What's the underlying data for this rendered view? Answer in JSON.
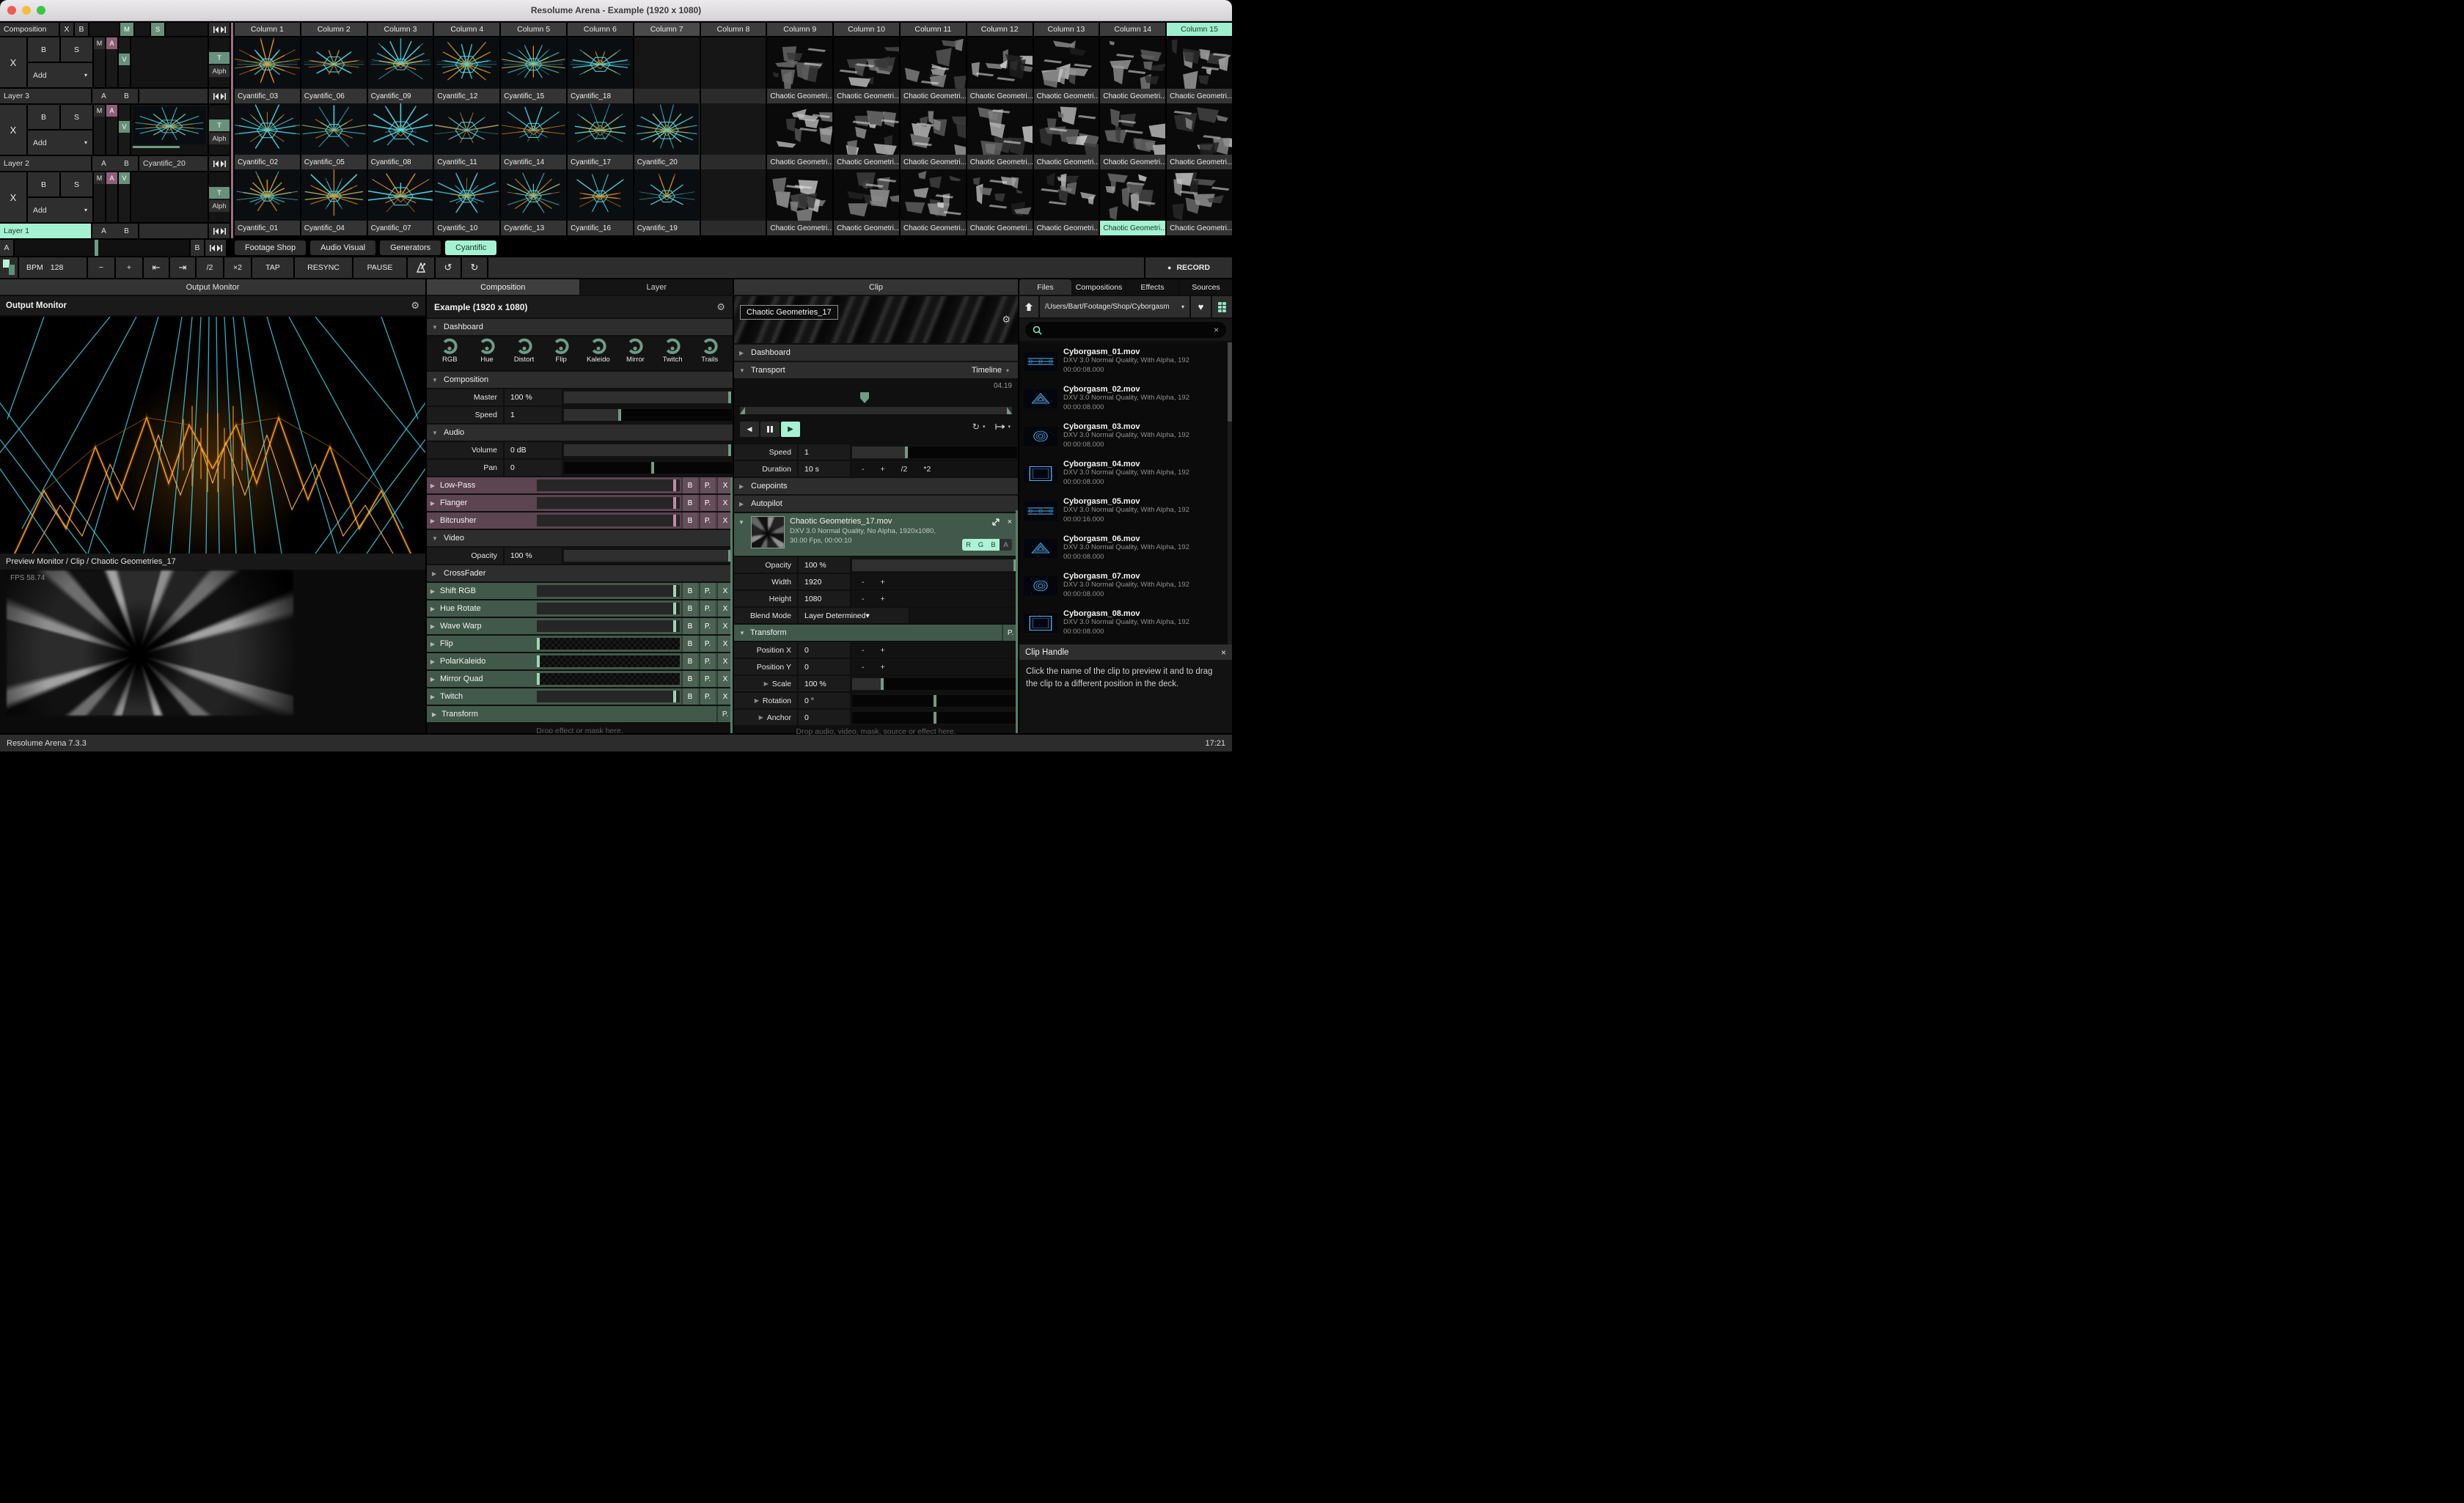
{
  "window": {
    "title": "Resolume Arena - Example (1920 x 1080)"
  },
  "colors": {
    "accent_mint": "#a5f2d3",
    "green_button": "#67917d",
    "purple_button": "#8f5f78",
    "audio_fx_bg": "#5c4450",
    "video_fx_bg": "#41594b",
    "slider_handle": "#6f9c86",
    "audio_fx_handle": "#c08ba4",
    "video_fx_handle": "#9fd4b8",
    "clip_cyan": "#49d8e8",
    "clip_orange": "#e8951c"
  },
  "icons": {
    "gear": "⚙",
    "heart": "♥",
    "chevron_down": "▾",
    "section_open": "▼",
    "section_closed": "▶",
    "close": "×",
    "play": "▶",
    "prev": "◀",
    "record_dot": "●",
    "undo": "↺",
    "redo": "↻",
    "nudge_left": "⇤",
    "nudge_right": "⇥",
    "loop": "↻"
  },
  "deck": {
    "composition": {
      "label": "Composition",
      "clear": "X",
      "bypass": "B",
      "master": "M",
      "solo": "S"
    },
    "layers": [
      {
        "name": "Layer 3",
        "clear": "X",
        "bypass": "B",
        "solo": "S",
        "blend": "Add",
        "m": "M",
        "a": "A",
        "v": "V",
        "t": "T",
        "alpha": "Alph",
        "ab_a": "A",
        "ab_b": "B",
        "clip": "",
        "selected": false,
        "v_top": false
      },
      {
        "name": "Layer 2",
        "clear": "X",
        "bypass": "B",
        "solo": "S",
        "blend": "Add",
        "m": "M",
        "a": "A",
        "v": "V",
        "t": "T",
        "alpha": "Alph",
        "ab_a": "A",
        "ab_b": "B",
        "clip": "Cyantific_20",
        "clip_seed": 20,
        "progress": 0.62,
        "selected": false,
        "v_top": false
      },
      {
        "name": "Layer 1",
        "clear": "X",
        "bypass": "B",
        "solo": "S",
        "blend": "Add",
        "m": "M",
        "a": "A",
        "v": "V",
        "t": "T",
        "alpha": "Alph",
        "ab_a": "A",
        "ab_b": "B",
        "clip": "",
        "selected": true,
        "v_top": true
      }
    ],
    "crossfader": {
      "a": "A",
      "b": "B",
      "position": 0.46
    }
  },
  "grid": {
    "columns": [
      "Column 1",
      "Column 2",
      "Column 3",
      "Column 4",
      "Column 5",
      "Column 6",
      "Column 7",
      "Column 8",
      "Column 9",
      "Column 10",
      "Column 11",
      "Column 12",
      "Column 13",
      "Column 14",
      "Column 15"
    ],
    "hover_col": 6,
    "active_col": 14,
    "rows": [
      [
        "Cyantific_03",
        "Cyantific_06",
        "Cyantific_09",
        "Cyantific_12",
        "Cyantific_15",
        "Cyantific_18",
        "",
        "",
        "Chaotic Geometri...",
        "Chaotic Geometri...",
        "Chaotic Geometri...",
        "Chaotic Geometri...",
        "Chaotic Geometri...",
        "Chaotic Geometri...",
        "Chaotic Geometri..."
      ],
      [
        "Cyantific_02",
        "Cyantific_05",
        "Cyantific_08",
        "Cyantific_11",
        "Cyantific_14",
        "Cyantific_17",
        "Cyantific_20",
        "",
        "Chaotic Geometri...",
        "Chaotic Geometri...",
        "Chaotic Geometri...",
        "Chaotic Geometri...",
        "Chaotic Geometri...",
        "Chaotic Geometri...",
        "Chaotic Geometri..."
      ],
      [
        "Cyantific_01",
        "Cyantific_04",
        "Cyantific_07",
        "Cyantific_10",
        "Cyantific_13",
        "Cyantific_16",
        "Cyantific_19",
        "",
        "Chaotic Geometri...",
        "Chaotic Geometri...",
        "Chaotic Geometri...",
        "Chaotic Geometri...",
        "Chaotic Geometri...",
        "Chaotic Geometri...",
        "Chaotic Geometri..."
      ]
    ],
    "selected": {
      "row": 1,
      "col": 6
    },
    "playing": {
      "row": 2,
      "col": 13
    }
  },
  "deck_tabs": {
    "items": [
      "Footage Shop",
      "Audio Visual",
      "Generators",
      "Cyantific"
    ],
    "active_index": 3
  },
  "bpm": {
    "label": "BPM",
    "value": "128",
    "cells": [
      {
        "label": "−",
        "w": 36,
        "name": "bpm-minus-button"
      },
      {
        "label": "+",
        "w": 36,
        "name": "bpm-plus-button"
      },
      {
        "icon": "nudge_left",
        "w": 34,
        "name": "bpm-nudge-down-button"
      },
      {
        "icon": "nudge_right",
        "w": 34,
        "name": "bpm-nudge-up-button"
      },
      {
        "label": "/2",
        "w": 36,
        "name": "bpm-half-button"
      },
      {
        "label": "×2",
        "w": 36,
        "name": "bpm-double-button"
      },
      {
        "label": "TAP",
        "w": 56,
        "name": "tap-button"
      },
      {
        "label": "RESYNC",
        "w": 78,
        "name": "resync-button"
      },
      {
        "label": "PAUSE",
        "w": 72,
        "name": "pause-button"
      },
      {
        "icon": "metronome",
        "w": 36,
        "name": "metronome-button"
      },
      {
        "icon": "undo",
        "w": 34,
        "name": "undo-button"
      },
      {
        "icon": "redo",
        "w": 34,
        "name": "redo-button"
      }
    ],
    "record": "RECORD"
  },
  "output_monitor": {
    "tab": "Output Monitor",
    "header": "Output Monitor",
    "preview_header": "Preview Monitor / Clip / Chaotic Geometries_17",
    "fps": "FPS 58.74"
  },
  "composition_panel": {
    "tabs": [
      {
        "label": "Composition"
      },
      {
        "label": "Layer"
      }
    ],
    "active_tab": 0,
    "title": "Example (1920 x 1080)",
    "dashboard_label": "Dashboard",
    "knobs": [
      "RGB",
      "Hue",
      "Distort",
      "Flip",
      "Kaleido",
      "Mirror",
      "Twitch",
      "Trails"
    ],
    "rows": [
      {
        "kind": "header",
        "label": "Composition",
        "open": true
      },
      {
        "kind": "param",
        "label": "Master",
        "value": "100 %",
        "slider": {
          "fill": 0.985,
          "handle": 0.985
        }
      },
      {
        "kind": "param",
        "label": "Speed",
        "value": "1",
        "slider": {
          "fill": 0.33,
          "handle": 0.33
        }
      },
      {
        "kind": "header",
        "label": "Audio",
        "open": true
      },
      {
        "kind": "param",
        "label": "Volume",
        "value": "0 dB",
        "slider": {
          "fill": 0.985,
          "handle": 0.985
        }
      },
      {
        "kind": "param",
        "label": "Pan",
        "value": "0",
        "slider": {
          "fill": 0,
          "handle": 0.53
        }
      },
      {
        "kind": "fx",
        "theme": "audio",
        "label": "Low-Pass",
        "buttons": [
          "B",
          "P.",
          "X"
        ],
        "handle": 0.965
      },
      {
        "kind": "fx",
        "theme": "audio",
        "label": "Flanger",
        "buttons": [
          "B",
          "P.",
          "X"
        ],
        "handle": 0.965
      },
      {
        "kind": "fx",
        "theme": "audio",
        "label": "Bitcrusher",
        "buttons": [
          "B",
          "P.",
          "X"
        ],
        "handle": 0.965
      },
      {
        "kind": "header",
        "label": "Video",
        "open": true
      },
      {
        "kind": "param",
        "label": "Opacity",
        "value": "100 %",
        "slider": {
          "fill": 0.985,
          "handle": 0.985
        }
      },
      {
        "kind": "header",
        "label": "CrossFader",
        "open": false
      },
      {
        "kind": "fx",
        "theme": "video",
        "label": "Shift RGB",
        "buttons": [
          "B",
          "P.",
          "X"
        ],
        "handle": 0.965
      },
      {
        "kind": "fx",
        "theme": "video",
        "label": "Hue Rotate",
        "buttons": [
          "B",
          "P.",
          "X"
        ],
        "handle": 0.965
      },
      {
        "kind": "fx",
        "theme": "video",
        "label": "Wave Warp",
        "buttons": [
          "B",
          "P.",
          "X"
        ],
        "handle": 0.965
      },
      {
        "kind": "fx",
        "theme": "video",
        "label": "Flip",
        "buttons": [
          "B",
          "P.",
          "X"
        ],
        "checker": true,
        "handle": 0.012
      },
      {
        "kind": "fx",
        "theme": "video",
        "label": "PolarKaleido",
        "buttons": [
          "B",
          "P.",
          "X"
        ],
        "checker": true,
        "handle": 0.012
      },
      {
        "kind": "fx",
        "theme": "video",
        "label": "Mirror Quad",
        "buttons": [
          "B",
          "P.",
          "X"
        ],
        "checker": true,
        "handle": 0.012
      },
      {
        "kind": "fx",
        "theme": "video",
        "label": "Twitch",
        "buttons": [
          "B",
          "P.",
          "X"
        ],
        "handle": 0.965
      },
      {
        "kind": "fxheader",
        "theme": "video",
        "label": "Transform",
        "button": "P."
      }
    ],
    "drop_hint": "Drop effect or mask here."
  },
  "clip_panel": {
    "tab": "Clip",
    "name": "Chaotic Geometries_17",
    "dashboard_label": "Dashboard",
    "transport_label": "Transport",
    "transport_mode": "Timeline",
    "time": "04.19",
    "playhead": 0.46,
    "rows_top": [
      {
        "kind": "param",
        "label": "Speed",
        "value": "1",
        "slider": {
          "fill": 0.33,
          "handle": 0.33
        }
      },
      {
        "kind": "duration",
        "label": "Duration",
        "value": "10 s",
        "buttons": [
          "-",
          "+",
          "/2",
          "*2"
        ]
      }
    ],
    "cuepoints_label": "Cuepoints",
    "autopilot_label": "Autopilot",
    "source": {
      "filename": "Chaotic Geometries_17.mov",
      "meta1": "DXV 3.0 Normal Quality, No Alpha, 1920x1080,",
      "meta2": "30.00 Fps, 00:00:10",
      "channels": [
        "R",
        "G",
        "B",
        "A"
      ],
      "active_channels": 3
    },
    "params": [
      {
        "kind": "param",
        "label": "Opacity",
        "value": "100 %",
        "slider": {
          "fill": 0.985,
          "handle": 0.985
        }
      },
      {
        "kind": "stepper",
        "label": "Width",
        "value": "1920",
        "buttons": [
          "-",
          "+"
        ]
      },
      {
        "kind": "stepper",
        "label": "Height",
        "value": "1080",
        "buttons": [
          "-",
          "+"
        ]
      },
      {
        "kind": "dropdown",
        "label": "Blend Mode",
        "value": "Layer Determined"
      }
    ],
    "transform_label": "Transform",
    "transform_button": "P.",
    "transform_rows": [
      {
        "kind": "stepper",
        "label": "Position X",
        "value": "0",
        "buttons": [
          "-",
          "+"
        ]
      },
      {
        "kind": "stepper",
        "label": "Position Y",
        "value": "0",
        "buttons": [
          "-",
          "+"
        ]
      },
      {
        "kind": "param",
        "label": "Scale",
        "value": "100 %",
        "arrow": true,
        "slider": {
          "fill": 0.18,
          "handle": 0.18
        }
      },
      {
        "kind": "param",
        "label": "Rotation",
        "value": "0 °",
        "arrow": true,
        "slider": {
          "fill": 0,
          "handle": 0.5
        }
      },
      {
        "kind": "param",
        "label": "Anchor",
        "value": "0",
        "arrow": true,
        "slider": {
          "fill": 0,
          "handle": 0.5
        }
      }
    ],
    "drop_hint": "Drop audio, video, mask, source or effect here."
  },
  "files_panel": {
    "tabs": [
      "Files",
      "Compositions",
      "Effects",
      "Sources"
    ],
    "active_tab": 0,
    "path": "/Users/Bart/Footage/Shop/Cyborgasm",
    "search_value": "",
    "files": [
      {
        "name": "Cyborgasm_01.mov",
        "meta": "DXV 3.0 Normal Quality, With Alpha, 192",
        "duration": "00:00:08.000"
      },
      {
        "name": "Cyborgasm_02.mov",
        "meta": "DXV 3.0 Normal Quality, With Alpha, 192",
        "duration": "00:00:08.000"
      },
      {
        "name": "Cyborgasm_03.mov",
        "meta": "DXV 3.0 Normal Quality, With Alpha, 192",
        "duration": "00:00:08.000"
      },
      {
        "name": "Cyborgasm_04.mov",
        "meta": "DXV 3.0 Normal Quality, With Alpha, 192",
        "duration": "00:00:08.000"
      },
      {
        "name": "Cyborgasm_05.mov",
        "meta": "DXV 3.0 Normal Quality, With Alpha, 192",
        "duration": "00:00:16.000"
      },
      {
        "name": "Cyborgasm_06.mov",
        "meta": "DXV 3.0 Normal Quality, With Alpha, 192",
        "duration": "00:00:08.000"
      },
      {
        "name": "Cyborgasm_07.mov",
        "meta": "DXV 3.0 Normal Quality, With Alpha, 192",
        "duration": "00:00:08.000"
      },
      {
        "name": "Cyborgasm_08.mov",
        "meta": "DXV 3.0 Normal Quality, With Alpha, 192",
        "duration": "00:00:08.000"
      }
    ]
  },
  "clip_handle": {
    "title": "Clip Handle",
    "body": "Click the name of the clip to preview it and to drag the clip to a different position in the deck."
  },
  "status_bar": {
    "left": "Resolume Arena 7.3.3",
    "right": "17:21"
  }
}
